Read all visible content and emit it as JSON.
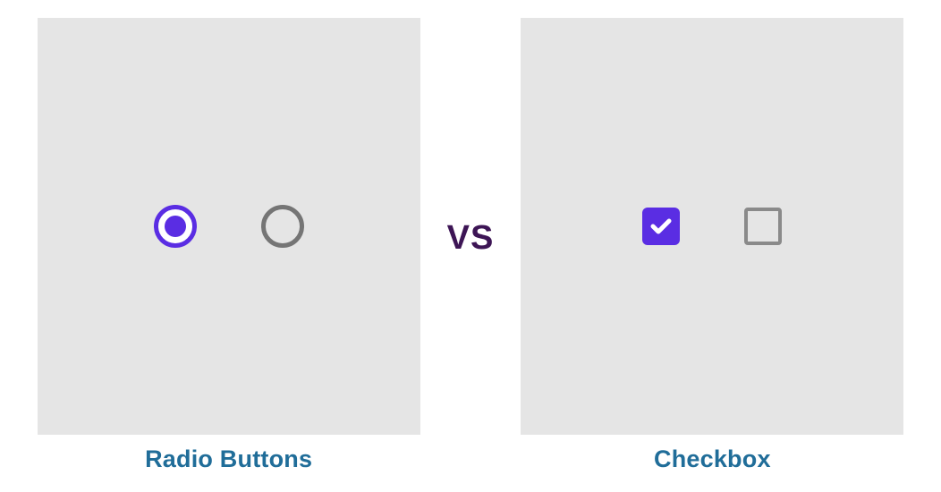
{
  "comparison": {
    "left": {
      "label": "Radio Buttons",
      "controls": [
        {
          "type": "radio",
          "state": "selected"
        },
        {
          "type": "radio",
          "state": "unselected"
        }
      ]
    },
    "separator": "VS",
    "right": {
      "label": "Checkbox",
      "controls": [
        {
          "type": "checkbox",
          "state": "checked"
        },
        {
          "type": "checkbox",
          "state": "unchecked"
        }
      ]
    }
  },
  "colors": {
    "accent": "#5a2de3",
    "panel_bg": "#e5e5e5",
    "label_text": "#206d99",
    "vs_text": "#3d1555",
    "neutral_border": "#757575"
  }
}
